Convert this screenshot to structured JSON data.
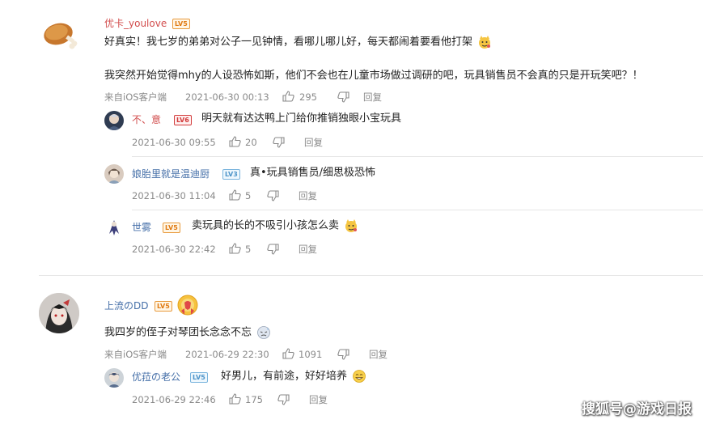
{
  "comments": [
    {
      "username": "优卡_youlove",
      "level": "LV5",
      "text_line1": "好真实！我七岁的弟弟对公子一见钟情，看哪儿哪儿好，每天都闹着要看他打架",
      "text_line2": "我突然开始觉得mhy的人设恐怖如斯，他们不会也在儿童市场做过调研的吧，玩具销售员不会真的只是开玩笑吧？！",
      "source": "来自iOS客户端",
      "time": "2021-06-30 00:13",
      "likes": "295",
      "reply_label": "回复",
      "replies": [
        {
          "username": "不、意",
          "level": "LV6",
          "text": "明天就有达达鸭上门给你推销独眼小宝玩具",
          "time": "2021-06-30 09:55",
          "likes": "20",
          "reply_label": "回复"
        },
        {
          "username": "娘胎里就是温迪厨",
          "level": "LV3",
          "text": "真•玩具销售员/细思极恐怖",
          "time": "2021-06-30 11:04",
          "likes": "5",
          "reply_label": "回复"
        },
        {
          "username": "世雾",
          "level": "LV5",
          "text": "卖玩具的长的不吸引小孩怎么卖",
          "time": "2021-06-30 22:42",
          "likes": "5",
          "reply_label": "回复"
        }
      ]
    },
    {
      "username": "上流のDD",
      "level": "LV5",
      "text_line1": "我四岁的侄子对琴团长念念不忘",
      "source": "来自iOS客户端",
      "time": "2021-06-29 22:30",
      "likes": "1091",
      "reply_label": "回复",
      "replies": [
        {
          "username": "优菈の老公",
          "level": "LV5",
          "text": "好男儿，有前途，好好培养",
          "time": "2021-06-29 22:46",
          "likes": "175",
          "reply_label": "回复"
        }
      ]
    }
  ],
  "watermark": "搜狐号@游戏日报",
  "colors": {
    "username": "#456fa8",
    "meta": "#8a8a8a",
    "level": "#e07a12"
  }
}
